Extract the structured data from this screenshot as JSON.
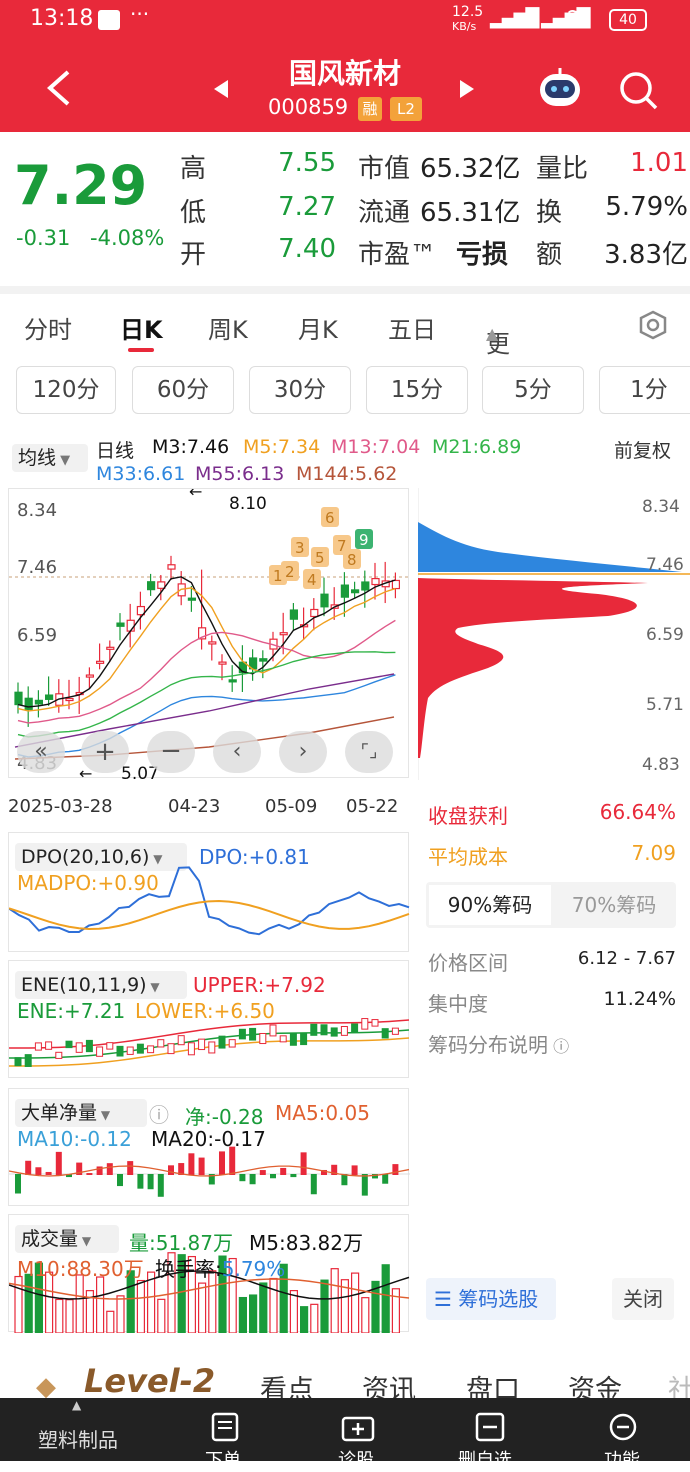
{
  "status": {
    "time": "13:18",
    "net": "12.5",
    "net_unit": "KB/s",
    "battery": "40"
  },
  "header": {
    "name": "国风新材",
    "code": "000859",
    "badge_rong": "融",
    "badge_l2": "L2"
  },
  "quote": {
    "price": "7.29",
    "change": "-0.31",
    "change_pct": "-4.08%",
    "rows": [
      {
        "l1": "高",
        "v1": "7.55",
        "l2": "市值",
        "v2": "65.32亿",
        "l3": "量比",
        "v3": "1.01"
      },
      {
        "l1": "低",
        "v1": "7.27",
        "l2": "流通",
        "v2": "65.31亿",
        "l3": "换",
        "v3": "5.79%"
      },
      {
        "l1": "开",
        "v1": "7.40",
        "l2": "市盈™",
        "v2": "亏损",
        "l3": "额",
        "v3": "3.83亿"
      }
    ]
  },
  "tabs": [
    "分时",
    "日K",
    "周K",
    "月K",
    "五日",
    "更多"
  ],
  "periods": [
    "120分",
    "60分",
    "30分",
    "15分",
    "5分",
    "1分"
  ],
  "ma": {
    "selector": "均线",
    "line": "日线",
    "m3": "M3:7.46",
    "m5": "M5:7.34",
    "m13": "M13:7.04",
    "m21": "M21:6.89",
    "m33": "M33:6.61",
    "m55": "M55:6.13",
    "m144": "M144:5.62",
    "fq": "前复权"
  },
  "kchart": {
    "y_labels": [
      "8.34",
      "7.46",
      "6.59",
      "5.71",
      "4.83"
    ],
    "high_note": "8.10",
    "low_note": "5.07",
    "dates": [
      "2025-03-28",
      "04-23",
      "05-09",
      "05-22"
    ],
    "markers": [
      "1",
      "2",
      "3",
      "4",
      "5",
      "6",
      "7",
      "8",
      "9"
    ]
  },
  "chip": {
    "y_labels": [
      "8.34",
      "7.46",
      "6.59",
      "5.71",
      "4.83"
    ],
    "profit_label": "收盘获利",
    "profit": "66.64%",
    "avg_label": "平均成本",
    "avg": "7.09",
    "tab90": "90%筹码",
    "tab70": "70%筹码",
    "range_label": "价格区间",
    "range": "6.12 - 7.67",
    "conc_label": "集中度",
    "conc": "11.24%",
    "desc": "筹码分布说明",
    "select_btn": "筹码选股",
    "close_btn": "关闭"
  },
  "dpo": {
    "name": "DPO(20,10,6)",
    "dpo": "DPO:+0.81",
    "madpo": "MADPO:+0.90"
  },
  "ene": {
    "name": "ENE(10,11,9)",
    "upper": "UPPER:+7.92",
    "ene": "ENE:+7.21",
    "lower": "LOWER:+6.50"
  },
  "bigorder": {
    "name": "大单净量",
    "net": "净:-0.28",
    "ma5": "MA5:0.05",
    "ma10": "MA10:-0.12",
    "ma20": "MA20:-0.17"
  },
  "volume": {
    "name": "成交量",
    "vol": "量:51.87万",
    "m5": "M5:83.82万",
    "m10": "M10:88.30万",
    "turnover_label": "换手率:",
    "turnover": "5.79%"
  },
  "bottom": {
    "level2": "Level-2",
    "tabs": [
      "看点",
      "资讯",
      "盘口",
      "资金",
      "社"
    ]
  },
  "navbar": {
    "items": [
      "塑料制品",
      "下单",
      "诊股",
      "删自选",
      "功能"
    ]
  },
  "colors": {
    "red": "#e8293a",
    "green": "#1a9b3a",
    "blue": "#2e86de",
    "orange": "#f0a020"
  }
}
